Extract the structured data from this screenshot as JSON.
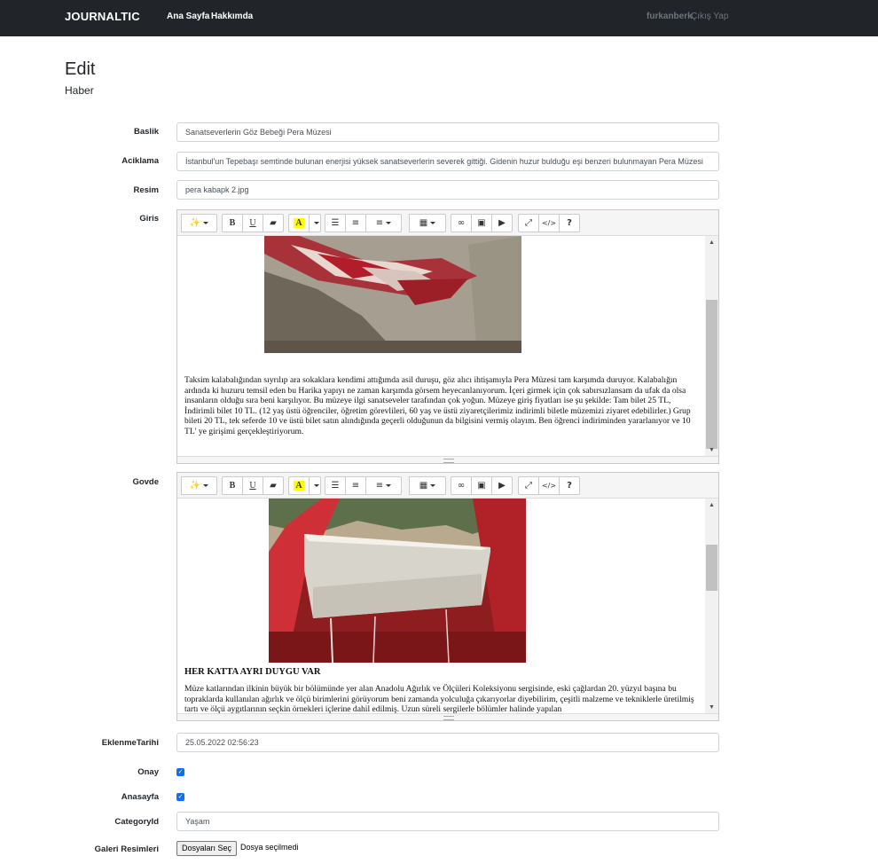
{
  "nav": {
    "brand": "JOURNALTIC",
    "links": [
      "Ana Sayfa",
      "Hakkımda"
    ],
    "user": "furkanberk",
    "logout": "Çıkış Yap"
  },
  "page": {
    "title": "Edit",
    "subtitle": "Haber"
  },
  "form": {
    "baslik": {
      "label": "Baslik",
      "value": "Sanatseverlerin Göz Bebeği Pera Müzesi"
    },
    "aciklama": {
      "label": "Aciklama",
      "value": "İstanbul'un Tepebaşı semtinde bulunan enerjisi yüksek sanatseverlerin severek gittiği. Gidenin huzur bulduğu  eşi benzeri bulunmayan Pera Müzesi"
    },
    "resim": {
      "label": "Resim",
      "value": "pera kabapk 2.jpg"
    },
    "giris": {
      "label": "Giris",
      "text": "Taksim kalabalığından sıyrılıp ara sokaklara kendimi attığımda asil duruşu,  göz alıcı ihtişamıyla Pera Müzesi  tam karşımda duruyor. Kalabalığın ardında ki huzuru temsil eden bu Harika yapıyı ne zaman karşımda görsem heyecanlanıyorum. İçeri girmek için çok sabırsızlansam da ufak da olsa insanların olduğu sıra beni karşılıyor. Bu müzeye ilgi sanatseveler tarafından çok yoğun. Müzeye giriş fiyatları ise şu şekilde:  Tam bilet 25 TL, İndirimli bilet 10 TL. (12 yaş üstü öğrenciler, öğretim görevlileri, 60 yaş ve üstü ziyaretçilerimiz indirimli biletle müzemizi ziyaret edebilirler.) Grup bileti 20 TL, tek seferde 10 ve üstü bilet satın alındığında geçerli olduğunun da bilgisini vermiş olayım. Ben öğrenci indiriminden yararlanıyor ve 10 TL' ye girişimi gerçekleştiriyorum."
    },
    "govde": {
      "label": "Govde",
      "heading": "HER KATTA AYRI DUYGU VAR",
      "text": "Müze katlarından ilkinin büyük bir bölümünde yer alan Anadolu Ağırlık ve Ölçüleri Koleksiyonu sergisinde, eski çağlardan 20. yüzyıl başına bu topraklarda kullanılan ağırlık ve ölçü birimlerini görüyorum beni zamanda yolculuğa çıkarıyorlar diyebilirim, çeşitli malzeme ve tekniklerle üretilmiş tartı ve ölçü aygıtlarının seçkin örnekleri içlerine dahil edilmiş. Uzun süreli sergilerle bölümler halinde yapılan"
    },
    "eklenme": {
      "label": "EklenmeTarihi",
      "value": "25.05.2022 02:56:23"
    },
    "onay": {
      "label": "Onay",
      "checked": true
    },
    "anasayfa": {
      "label": "Anasayfa",
      "checked": true
    },
    "category": {
      "label": "CategoryId",
      "value": "Yaşam"
    },
    "galeri": {
      "label": "Galeri Resimleri",
      "button": "Dosyaları Seç",
      "status": "Dosya seçilmedi"
    }
  },
  "toolbar_icons": [
    "magic-icon",
    "bold-icon",
    "underline-icon",
    "eraser-icon",
    "font-color-icon",
    "unordered-list-icon",
    "ordered-list-icon",
    "align-icon",
    "table-icon",
    "link-icon",
    "image-icon",
    "video-icon",
    "fullscreen-icon",
    "code-view-icon",
    "help-icon"
  ],
  "toolbar_labels": {
    "bold": "B",
    "underline": "U",
    "color": "A",
    "help": "?",
    "code": "</>"
  },
  "colors": {
    "navbar": "#212529",
    "checkbox": "#0d6efd",
    "highlight": "#ffff00"
  }
}
